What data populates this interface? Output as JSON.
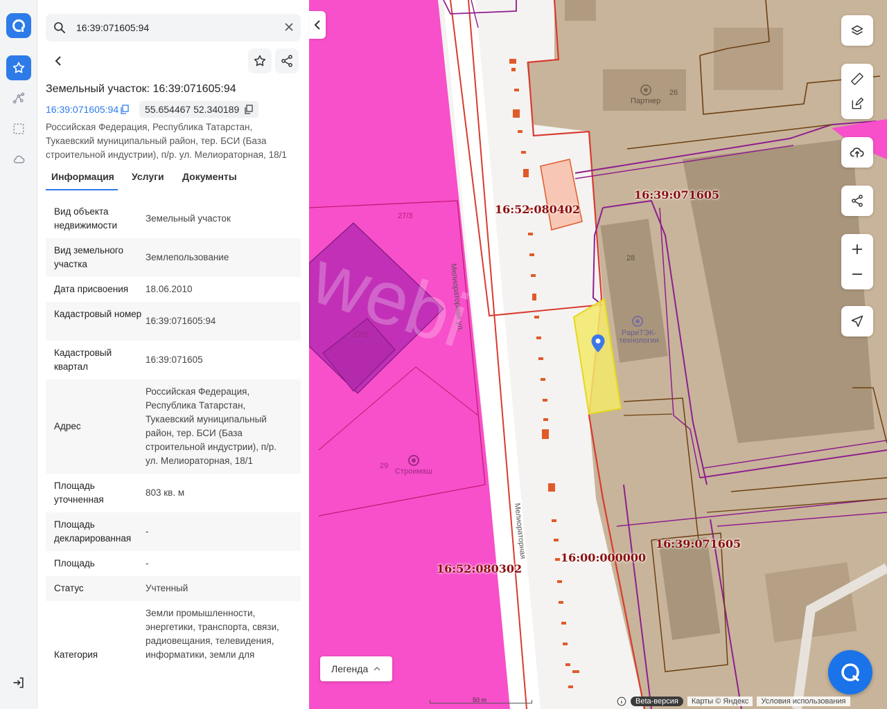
{
  "search": {
    "value": "16:39:071605:94"
  },
  "object": {
    "title": "Земельный участок: 16:39:071605:94",
    "cad_number_link": "16:39:071605:94",
    "coords": "55.654467 52.340189",
    "address": "Российская Федерация, Республика Татарстан, Тукаевский муниципальный район, тер. БСИ (База строительной индустрии), п/р. ул. Мелиораторная, 18/1"
  },
  "tabs": [
    "Информация",
    "Услуги",
    "Документы"
  ],
  "info_rows": [
    {
      "key": "Вид объекта недвижимости",
      "value": "Земельный участок"
    },
    {
      "key": "Вид земельного участка",
      "value": "Землепользование"
    },
    {
      "key": "Дата присвоения",
      "value": "18.06.2010"
    },
    {
      "key": "Кадастровый номер",
      "value": "16:39:071605:94"
    },
    {
      "key": "Кадастровый квартал",
      "value": "16:39:071605"
    },
    {
      "key": "Адрес",
      "value": "Российская Федерация, Республика Татарстан, Тукаевский муниципальный район, тер. БСИ (База строительной индустрии), п/р. ул. Мелиораторная, 18/1"
    },
    {
      "key": "Площадь уточненная",
      "value": "803 кв. м"
    },
    {
      "key": "Площадь декларированная",
      "value": "-"
    },
    {
      "key": "Площадь",
      "value": "-"
    },
    {
      "key": "Статус",
      "value": "Учтенный"
    },
    {
      "key": "Категория",
      "value": "Земли промышленности, энергетики, транспорта, связи, радиовещания, телевидения, информатики, земли для"
    }
  ],
  "map": {
    "labels": {
      "q1": "16:52:080402",
      "q2": "16:39:071605",
      "q3": "16:39:071605",
      "q4": "16:52:080302",
      "q5": "16:00:000000"
    },
    "street1": "Мелиораторная ул.",
    "street2": "Мелиораторная",
    "poi_partner": "Партнер",
    "poi_rari": "РариТЭК-технологии",
    "poi_stroimash": "Строимаш",
    "house_26": "26",
    "house_28": "28",
    "house_29": "29",
    "house_272": "27/2",
    "house_273": "27/3",
    "watermark": "webi"
  },
  "legend_label": "Легенда",
  "scale_label": "50 m",
  "footer": {
    "beta": "Beta-версия",
    "maps": "Карты © Яндекс",
    "terms": "Условия использования"
  },
  "colors": {
    "accent": "#2d7be8",
    "zone_magenta": "#f84fca",
    "building_tan": "#c8b49a",
    "selected_parcel": "#f3e96a",
    "boundary_red": "#d93a2f",
    "boundary_purple": "#8e1e8e",
    "boundary_brown": "#6b3f12"
  }
}
